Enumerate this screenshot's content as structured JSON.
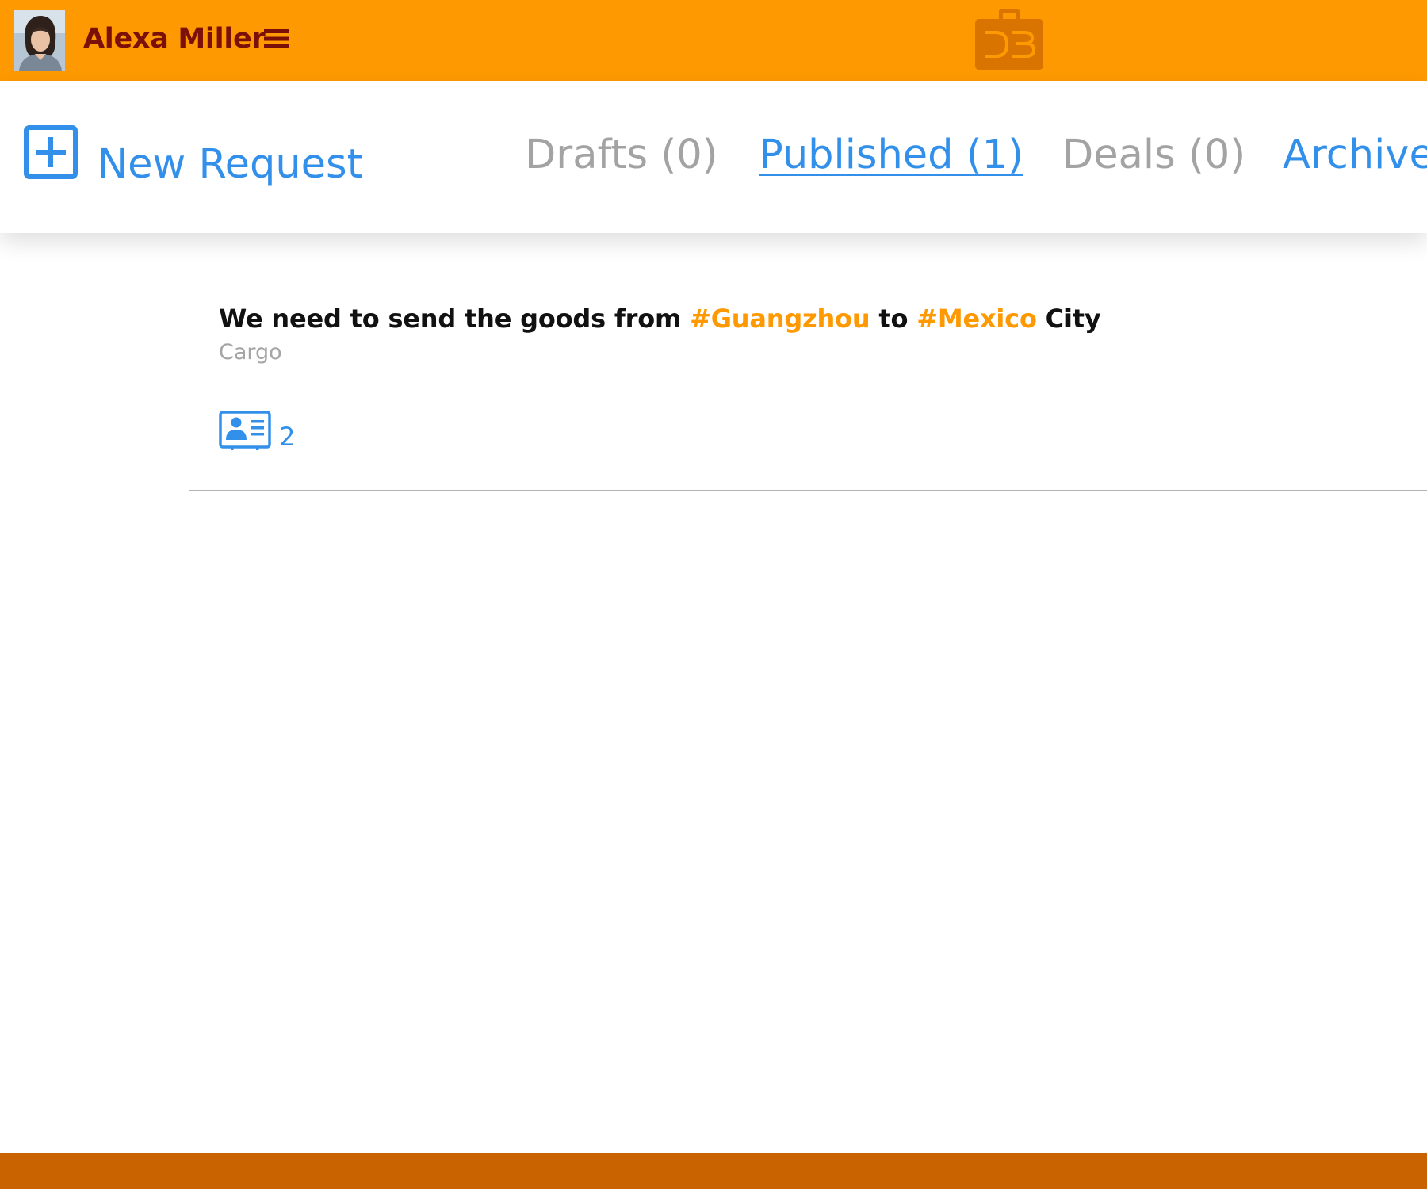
{
  "header": {
    "user_name": "Alexa Miller",
    "brand_color": "#fe9901",
    "avatar_icon": "user-avatar-photo",
    "menu_icon": "hamburger-menu-icon",
    "logo_icon": "briefcase-logo-icon"
  },
  "toolbar": {
    "new_request_label": "New Request",
    "new_request_icon": "plus-square-icon",
    "tabs": [
      {
        "label": "Drafts (0)",
        "state": "inactive"
      },
      {
        "label": "Published (1)",
        "state": "active"
      },
      {
        "label": "Deals (0)",
        "state": "inactive"
      },
      {
        "label": "Archive",
        "state": "link"
      }
    ]
  },
  "requests": [
    {
      "title_parts": [
        "We need to send the goods from ",
        "#Guangzhou",
        " to ",
        "#Mexico",
        " City"
      ],
      "category": "Cargo",
      "contacts_icon": "contact-card-icon",
      "contacts_count": "2"
    }
  ],
  "colors": {
    "accent_blue": "#3390ea",
    "footer": "#c96300",
    "hashtag": "#fe9901"
  }
}
